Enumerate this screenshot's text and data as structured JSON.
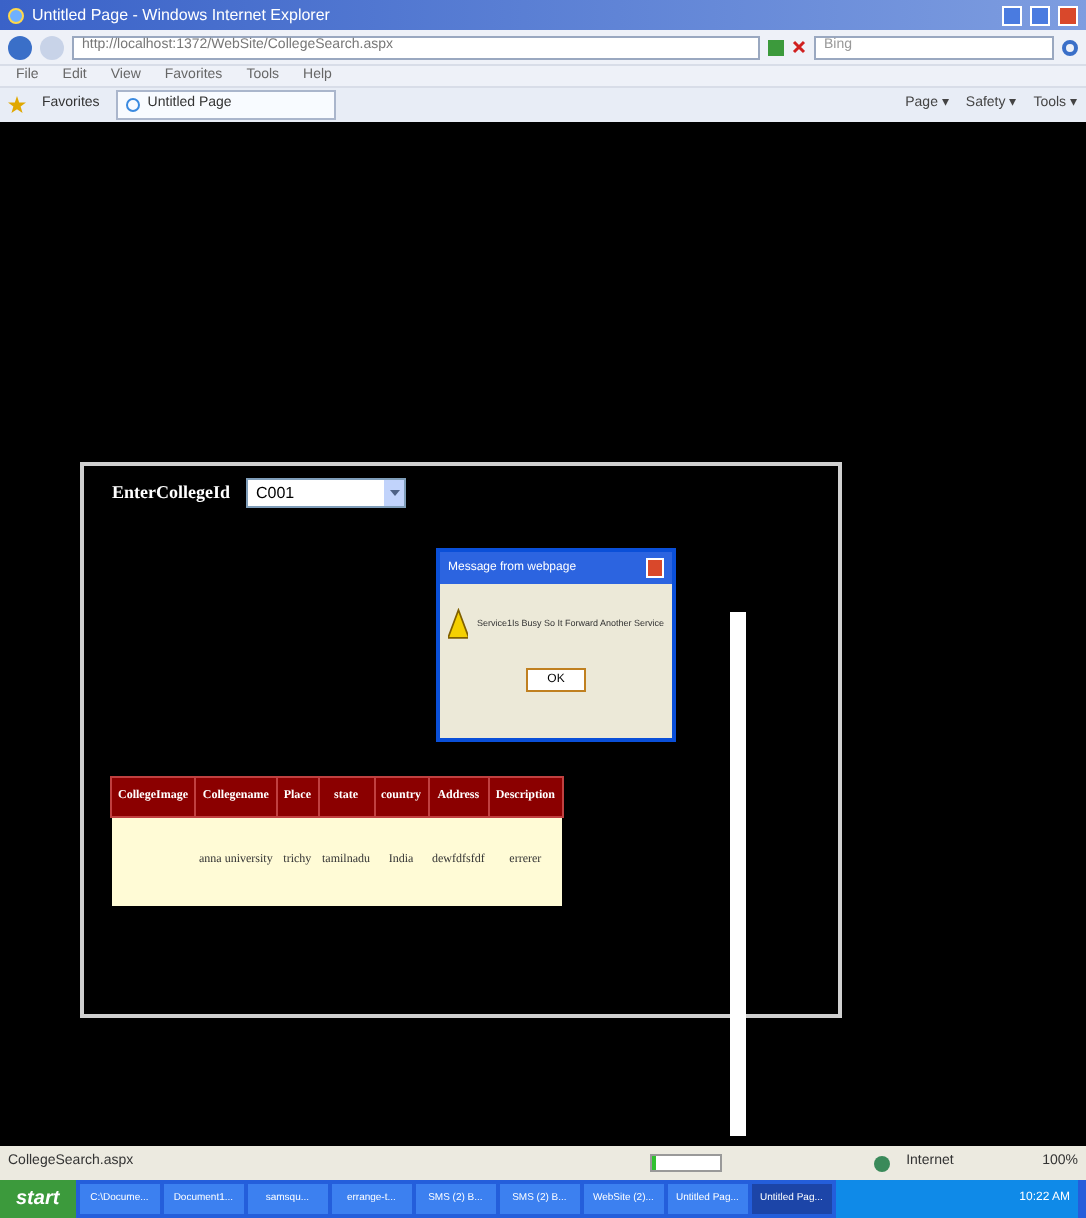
{
  "window": {
    "title": "Untitled Page - Windows Internet Explorer"
  },
  "address_bar": {
    "url": "http://localhost:1372/WebSite/CollegeSearch.aspx",
    "search_placeholder": "Bing"
  },
  "menu": [
    "File",
    "Edit",
    "View",
    "Favorites",
    "Tools",
    "Help"
  ],
  "favorites_bar": {
    "favorites": "Favorites",
    "tab": "Untitled Page",
    "commands": [
      "Page ▾",
      "Safety ▾",
      "Tools ▾"
    ]
  },
  "form": {
    "label": "EnterCollegeId",
    "value": "C001"
  },
  "table": {
    "columns": [
      "CollegeImage",
      "Collegename",
      "Place",
      "state",
      "country",
      "Address",
      "Description"
    ],
    "rows": [
      [
        "",
        "anna university",
        "trichy",
        "tamilnadu",
        "India",
        "dewfdfsfdf",
        "errerer"
      ]
    ]
  },
  "dialog": {
    "title": "Message from webpage",
    "message": "Service1Is Busy So It Forward Another Service",
    "button": "OK"
  },
  "status_bar": {
    "text": "CollegeSearch.aspx",
    "progress": {
      "level": 0.05
    },
    "zone": "Internet",
    "zoom": "100%"
  },
  "taskbar": {
    "start": "start",
    "items": [
      {
        "label": "C:\\Docume...",
        "selected": false
      },
      {
        "label": "Document1...",
        "selected": false
      },
      {
        "label": "samsqu...",
        "selected": false
      },
      {
        "label": "errange-t...",
        "selected": false
      },
      {
        "label": "SMS (2) B...",
        "selected": false
      },
      {
        "label": "SMS (2) B...",
        "selected": false
      },
      {
        "label": "WebSite (2)...",
        "selected": false
      },
      {
        "label": "Untitled Pag...",
        "selected": false
      },
      {
        "label": "Untitled Pag...",
        "selected": true
      }
    ],
    "clock": "10:22 AM"
  }
}
